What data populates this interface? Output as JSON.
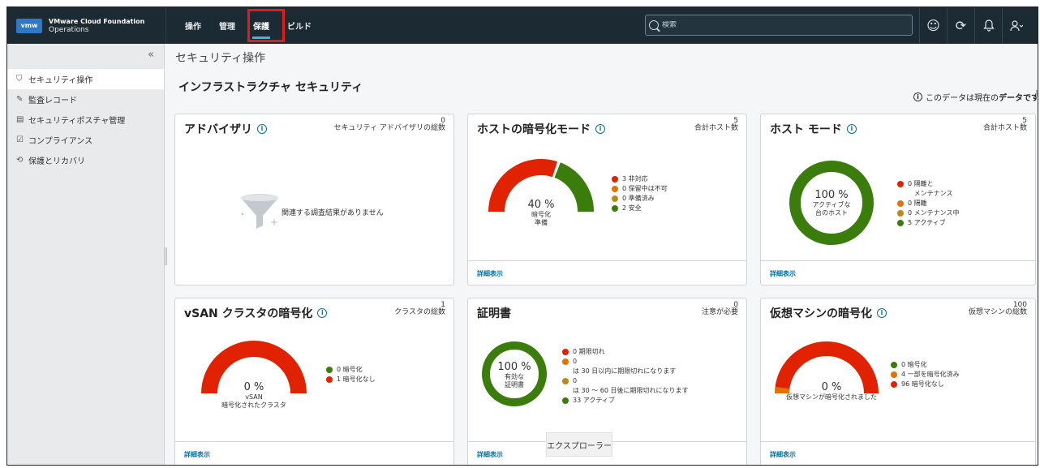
{
  "app": {
    "logo": "vmw",
    "title_line1": "VMware Cloud Foundation",
    "title_line2": "Operations"
  },
  "nav": [
    {
      "label": "操作",
      "active": false
    },
    {
      "label": "管理",
      "active": false
    },
    {
      "label": "保護",
      "active": true
    },
    {
      "label": "ビルド",
      "active": false
    }
  ],
  "search": {
    "placeholder": "検索"
  },
  "top_icons": [
    "smiley-icon",
    "refresh-icon",
    "bell-icon",
    "user-icon"
  ],
  "sidebar": {
    "items": [
      {
        "label": "セキュリティ操作",
        "icon": "shield-icon",
        "active": true
      },
      {
        "label": "監査レコード",
        "icon": "edit-icon",
        "active": false
      },
      {
        "label": "セキュリティポスチャ管理",
        "icon": "document-icon",
        "active": false
      },
      {
        "label": "コンプライアンス",
        "icon": "checklist-icon",
        "active": false
      },
      {
        "label": "保護とリカバリ",
        "icon": "recovery-icon",
        "active": false
      }
    ]
  },
  "page": {
    "title": "セキュリティ操作",
    "section_title": "インフラストラクチャ セキュリティ",
    "data_note_prefix": "このデータは現在の",
    "data_note_bold": "データです"
  },
  "details_label": "詳細表示",
  "cards": {
    "advisories": {
      "title": "アドバイザリ",
      "count": "0",
      "count_label": "セキュリティ アドバイザリの総数",
      "empty_text": "関連する調査結果がありません"
    },
    "host_encryption": {
      "title": "ホストの暗号化モード",
      "count": "5",
      "count_label": "合計ホスト数",
      "percent": "40 %",
      "center_label_1": "暗号化",
      "center_label_2": "準備",
      "legend": [
        {
          "value": "3",
          "label": "非対応",
          "color": "#e12200"
        },
        {
          "value": "0",
          "label": "保留中は不可",
          "color": "#e57200"
        },
        {
          "value": "0",
          "label": "準備済み",
          "color": "#b9891a"
        },
        {
          "value": "2",
          "label": "安全",
          "color": "#3b7d0c"
        }
      ],
      "fraction_green": 0.4
    },
    "host_mode": {
      "title": "ホスト モード",
      "count": "5",
      "count_label": "合計ホスト数",
      "percent": "100 %",
      "center_label_1": "アクティブな",
      "center_label_2": "台のホスト",
      "legend": [
        {
          "value": "0",
          "label": "隔離と\nメンテナンス",
          "color": "#e12200"
        },
        {
          "value": "0",
          "label": "隔離",
          "color": "#e57200"
        },
        {
          "value": "0",
          "label": "メンテナンス中",
          "color": "#b9891a"
        },
        {
          "value": "5",
          "label": "アクティブ",
          "color": "#3b7d0c"
        }
      ]
    },
    "vsan": {
      "title": "vSAN クラスタの暗号化",
      "count": "1",
      "count_label": "クラスタの総数",
      "percent": "0 %",
      "center_label_1": "vSAN",
      "center_label_2": "暗号化されたクラスタ",
      "legend": [
        {
          "value": "0",
          "label": "暗号化",
          "color": "#3b7d0c"
        },
        {
          "value": "1",
          "label": "暗号化なし",
          "color": "#e12200"
        }
      ]
    },
    "certificates": {
      "title": "証明書",
      "count": "0",
      "count_label": "注意が必要",
      "percent": "100 %",
      "center_label_1": "有効な",
      "center_label_2": "証明書",
      "legend": [
        {
          "value": "0",
          "label": "期限切れ",
          "color": "#e12200"
        },
        {
          "value": "0",
          "label": "は 30 日以内に期限切れになります",
          "color": "#e57200"
        },
        {
          "value": "0",
          "label": "は 30 ～ 60 日後に期限切れになります",
          "color": "#b9891a"
        },
        {
          "value": "33",
          "label": "アクティブ",
          "color": "#3b7d0c"
        }
      ]
    },
    "vm_encryption": {
      "title": "仮想マシンの暗号化",
      "count": "100",
      "count_label": "仮想マシンの総数",
      "percent": "0 %",
      "center_label_1": "仮想マシンが暗号化されました",
      "legend": [
        {
          "value": "0",
          "label": "暗号化",
          "color": "#3b7d0c"
        },
        {
          "value": "4",
          "label": "一部を暗号化済み",
          "color": "#e57200"
        },
        {
          "value": "96",
          "label": "暗号化なし",
          "color": "#e12200"
        }
      ]
    }
  },
  "tooltip": "エクスプローラー"
}
